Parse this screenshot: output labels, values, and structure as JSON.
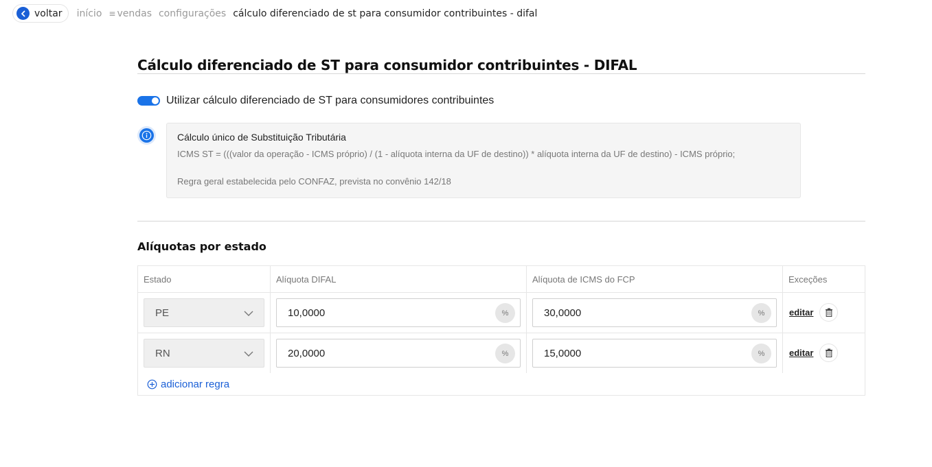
{
  "topbar": {
    "back_label": "voltar",
    "breadcrumbs": {
      "inicio": "início",
      "vendas": "vendas",
      "configuracoes": "configurações",
      "current": "cálculo diferenciado de st para consumidor contribuintes - difal"
    }
  },
  "page": {
    "title": "Cálculo diferenciado de ST para consumidor contribuintes - DIFAL"
  },
  "toggle": {
    "label": "Utilizar cálculo diferenciado de ST para consumidores contribuintes",
    "enabled": true,
    "color": "#1a73e8"
  },
  "info": {
    "icon": "info-icon",
    "title": "Cálculo único de Substituição Tributária",
    "formula": "ICMS ST = (((valor da operação - ICMS próprio) / (1 - alíquota interna da UF de destino)) * alíquota interna da UF de destino) - ICMS próprio;",
    "rule": "Regra geral estabelecida pelo CONFAZ, prevista no convênio 142/18"
  },
  "rates": {
    "section_title": "Alíquotas por estado",
    "headers": {
      "estado": "Estado",
      "difal": "Alíquota DIFAL",
      "fcp": "Alíquota de ICMS do FCP",
      "excecoes": "Exceções"
    },
    "rows": [
      {
        "estado": "PE",
        "difal": "10,0000",
        "fcp": "30,0000",
        "unit": "%",
        "edit": "editar"
      },
      {
        "estado": "RN",
        "difal": "20,0000",
        "fcp": "15,0000",
        "unit": "%",
        "edit": "editar"
      }
    ],
    "add_label": "adicionar regra"
  },
  "colors": {
    "accent": "#1a5fd6",
    "toggle": "#1a73e8"
  }
}
